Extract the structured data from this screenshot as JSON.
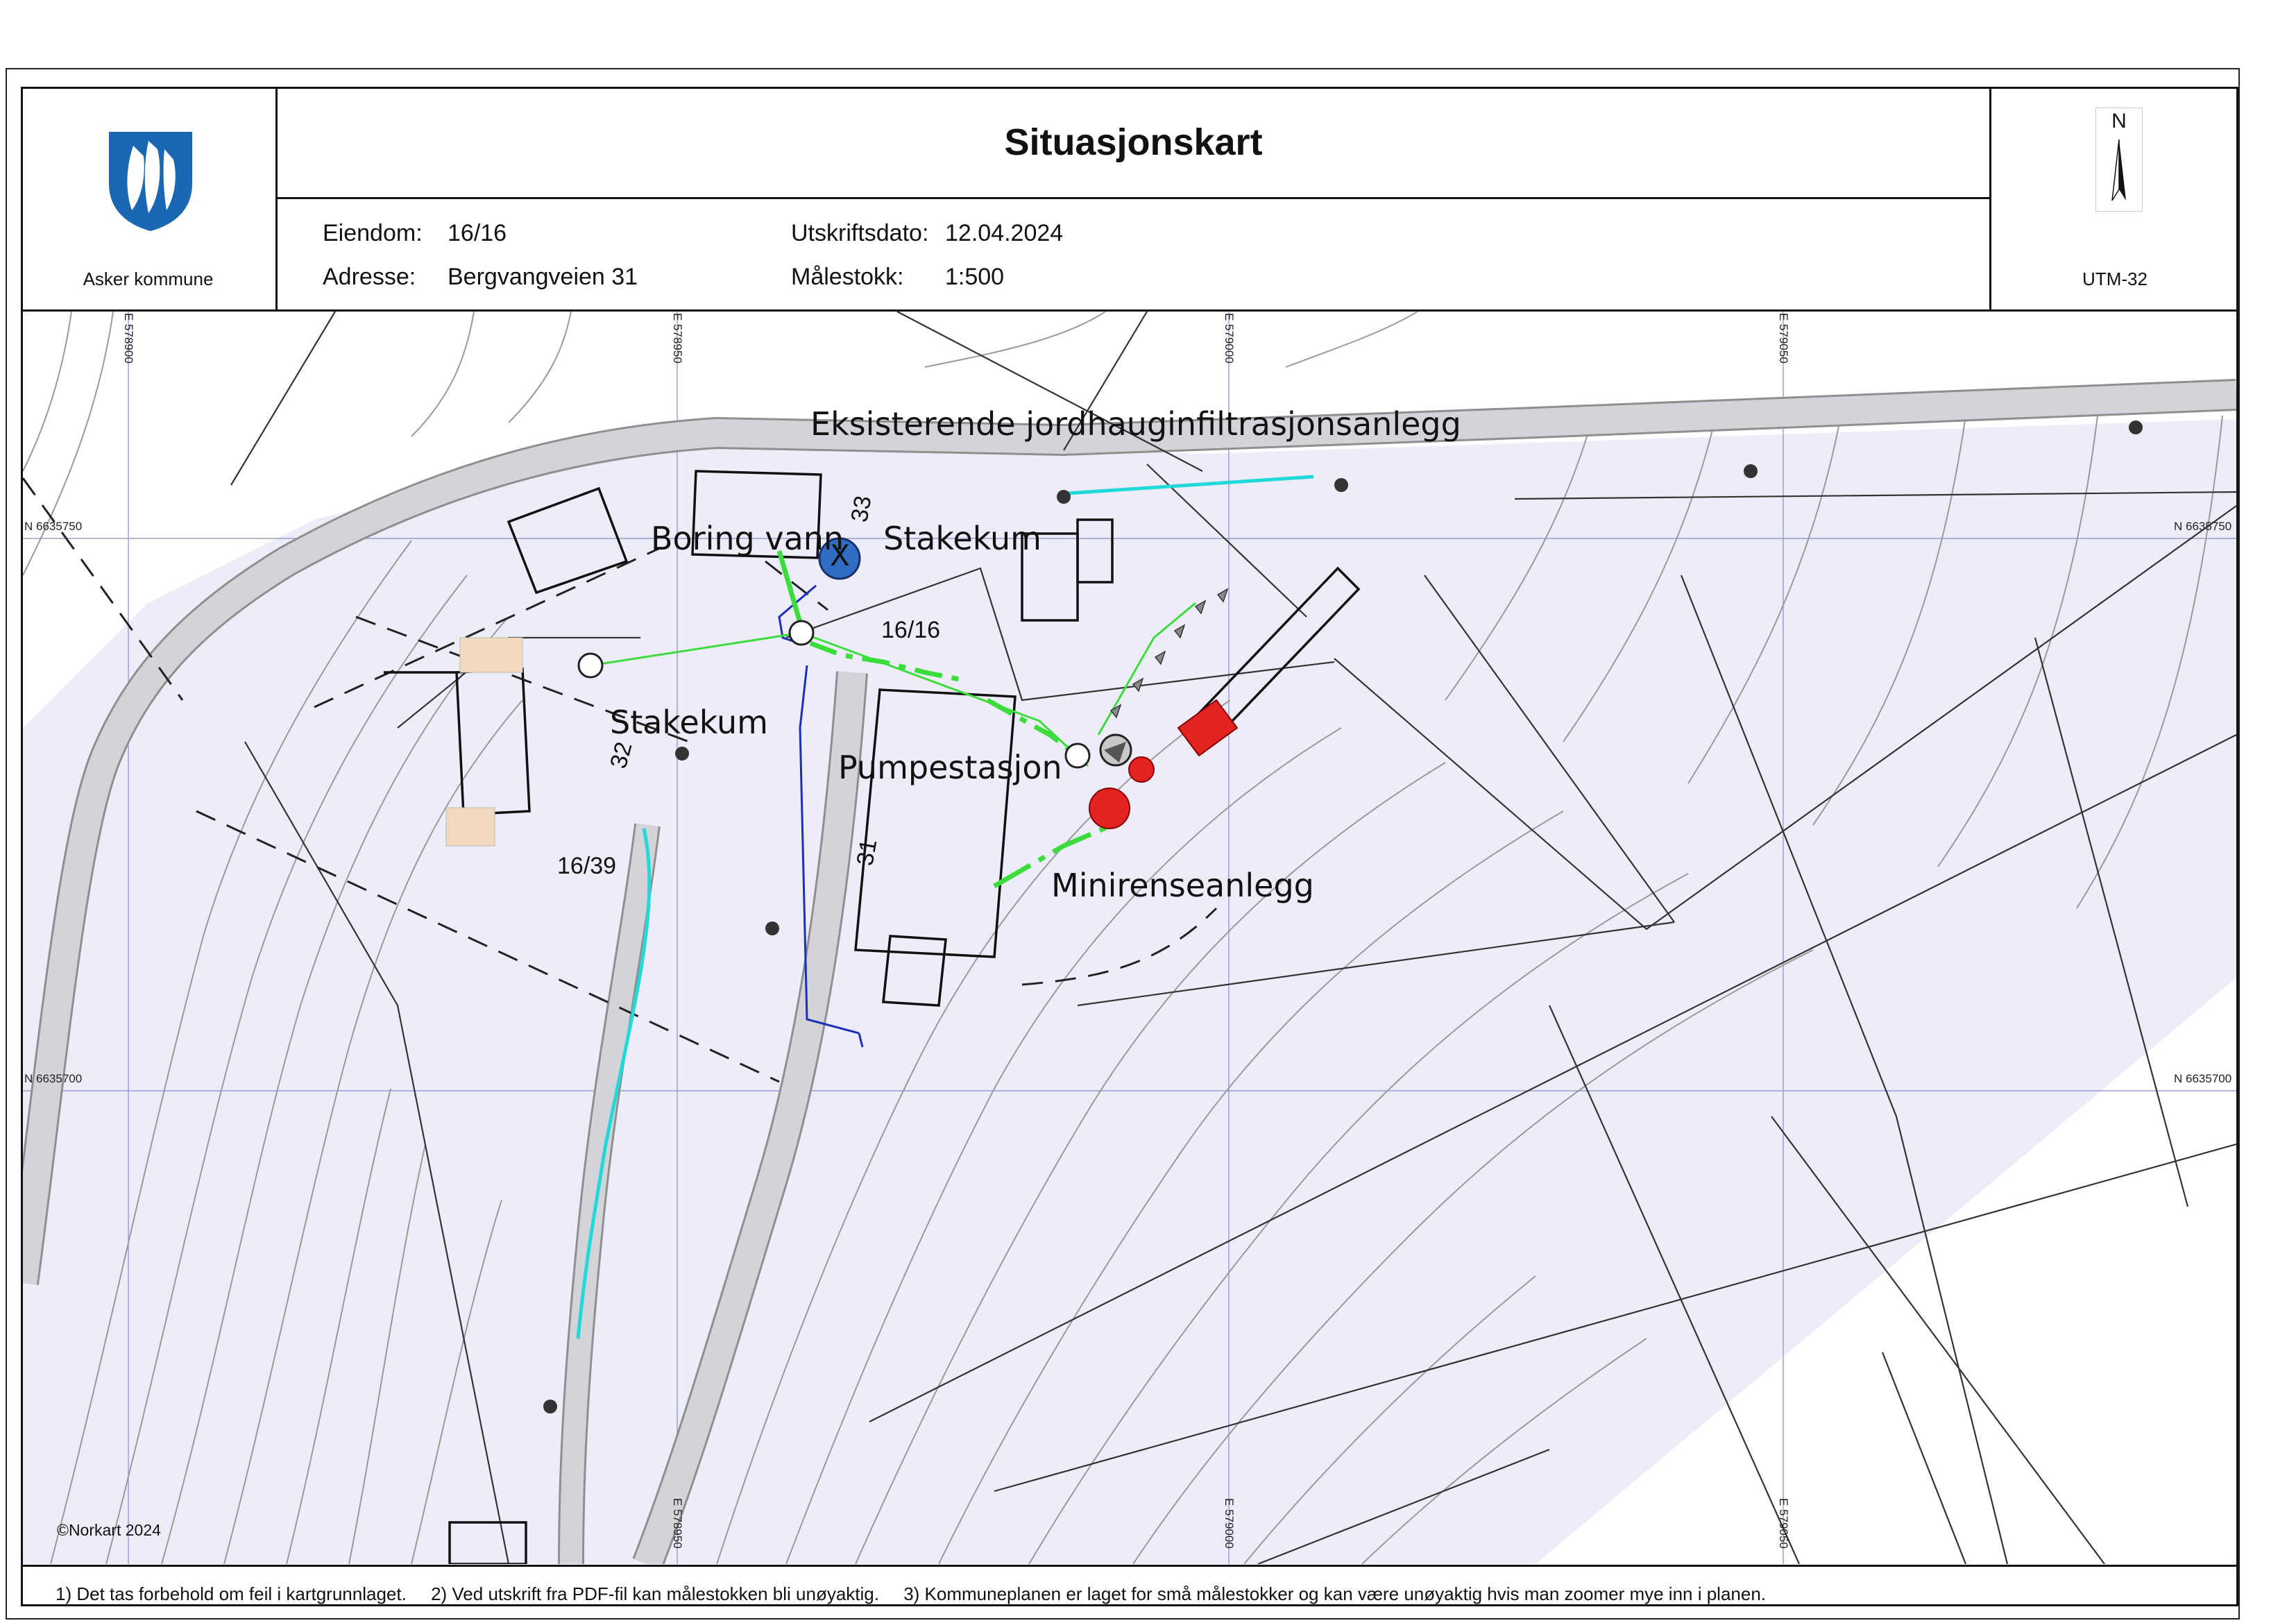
{
  "header": {
    "title": "Situasjonskart",
    "organization": "Asker kommune",
    "property_label": "Eiendom:",
    "property_value": "16/16",
    "address_label": "Adresse:",
    "address_value": "Bergvangveien 31",
    "print_date_label": "Utskriftsdato:",
    "print_date_value": "12.04.2024",
    "scale_label": "Målestokk:",
    "scale_value": "1:500",
    "north_label": "N",
    "projection": "UTM-32"
  },
  "map": {
    "labels": {
      "existing_system": "Eksisterende jordhauginfiltrasjonsanlegg",
      "water_drilling": "Boring vann",
      "stakekum_top": "Stakekum",
      "stakekum_left": "Stakekum",
      "pump_station": "Pumpestasjon",
      "mini_plant": "Minirenseanlegg",
      "parcel_main": "16/16",
      "parcel_west": "16/39",
      "house_33": "33",
      "house_32": "32",
      "house_31": "31",
      "well_symbol": "X"
    },
    "coords": {
      "e1": "E 578900",
      "e2": "E 578950",
      "e3": "E 579000",
      "e4": "E 579050",
      "n1_left": "N 6635750",
      "n1_right": "N 6635750",
      "n2_left": "N 6635700",
      "n2_right": "N 6635700"
    },
    "colors": {
      "parcel_fill": "#ecedf9",
      "road": "#cfd0d8",
      "sewer_green": "#3ddc3d",
      "water_blue": "#1b2fb8",
      "cyan_line": "#22d8d8",
      "equipment_red": "#e32222",
      "well_blue": "#2f6ec4"
    }
  },
  "copyright": "©Norkart 2024",
  "footer": {
    "note1": "1) Det tas forbehold om feil i kartgrunnlaget.",
    "note2": "2) Ved utskrift fra PDF-fil kan målestokken bli unøyaktig.",
    "note3": "3) Kommuneplanen er laget for små målestokker og kan være unøyaktig hvis man zoomer mye inn i planen."
  }
}
